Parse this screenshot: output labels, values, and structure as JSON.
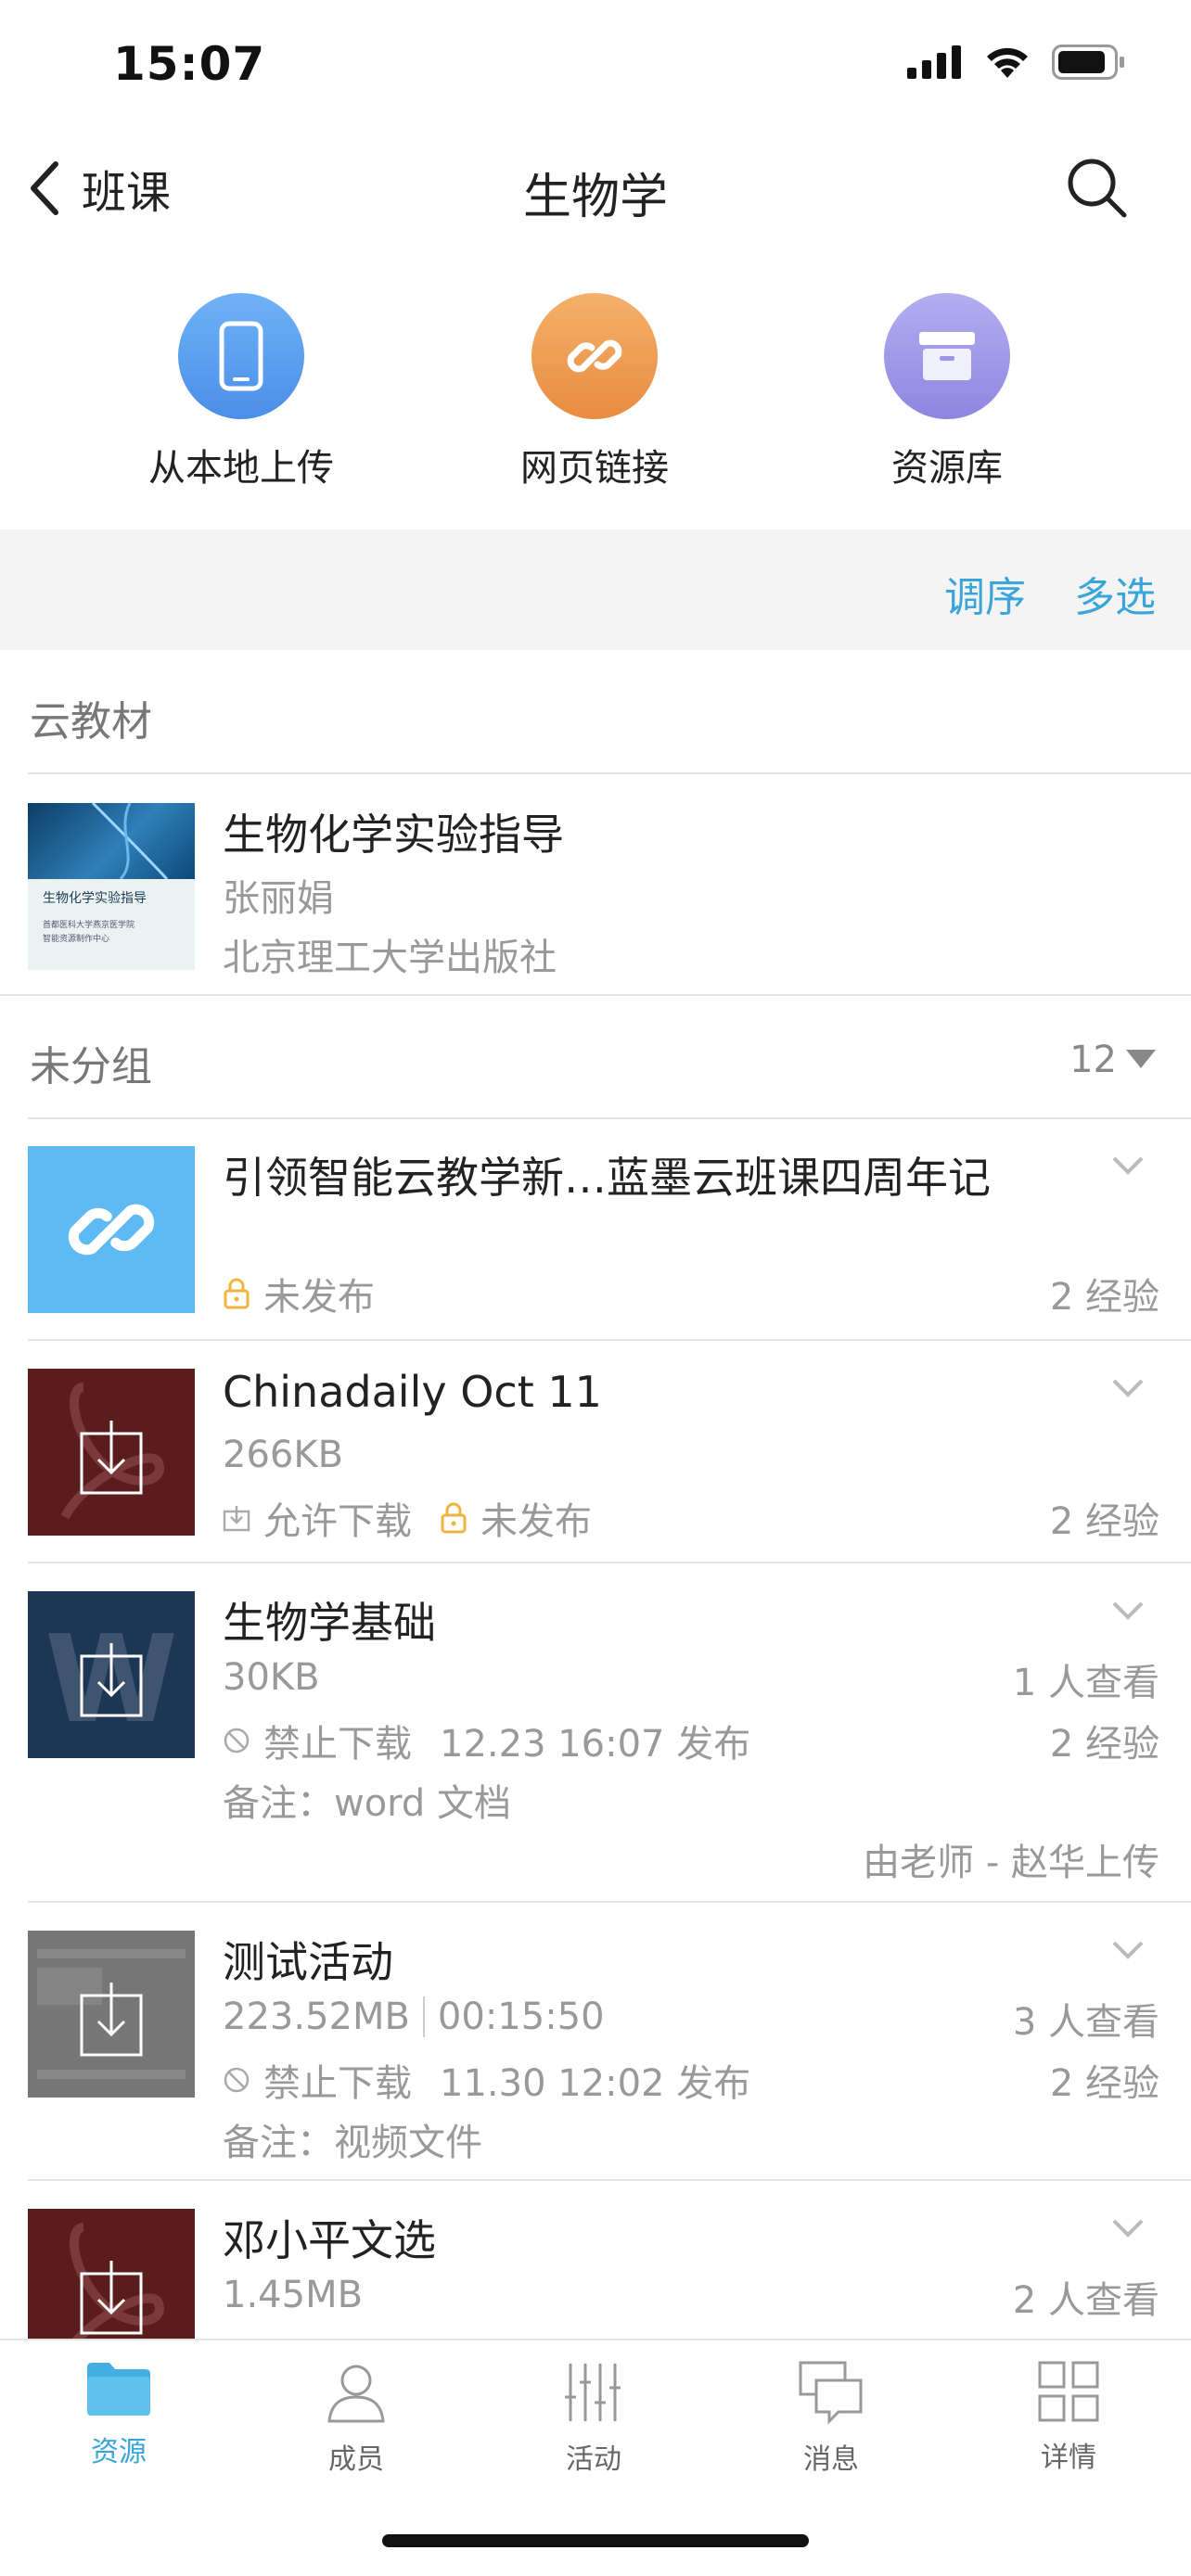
{
  "status": {
    "time": "15:07"
  },
  "nav": {
    "back_label": "班课",
    "title": "生物学"
  },
  "quick_actions": [
    {
      "label": "从本地上传",
      "icon": "phone-icon",
      "color": "#5aa0f0"
    },
    {
      "label": "网页链接",
      "icon": "link-icon",
      "color": "#ef9a50"
    },
    {
      "label": "资源库",
      "icon": "archive-icon",
      "color": "#9c96e8"
    }
  ],
  "toolbar": {
    "reorder_label": "调序",
    "multiselect_label": "多选"
  },
  "cloud_section": {
    "title": "云教材",
    "book": {
      "title": "生物化学实验指导",
      "author": "张丽娟",
      "publisher": "北京理工大学出版社",
      "cover_title": "生物化学实验指导",
      "cover_org": "首都医科大学燕京医学院",
      "cover_sub": "智能资源制作中心"
    }
  },
  "ungrouped": {
    "title": "未分组",
    "count": "12"
  },
  "items": [
    {
      "title": "引领智能云教学新…蓝墨云班课四周年记",
      "status": "未发布",
      "exp": "2 经验"
    },
    {
      "title": "Chinadaily Oct 11",
      "size": "266KB",
      "download": "允许下载",
      "status": "未发布",
      "exp": "2 经验"
    },
    {
      "title": "生物学基础",
      "size": "30KB",
      "download": "禁止下载",
      "publish": "12.23 16:07 发布",
      "views": "1 人查看",
      "exp": "2 经验",
      "note": "备注：word 文档",
      "uploader": "由老师 - 赵华上传"
    },
    {
      "title": "测试活动",
      "size": "223.52MB",
      "duration": "00:15:50",
      "download": "禁止下载",
      "publish": "11.30 12:02 发布",
      "views": "3 人查看",
      "exp": "2 经验",
      "note": "备注：视频文件"
    },
    {
      "title": "邓小平文选",
      "size": "1.45MB",
      "views": "2 人查看"
    }
  ],
  "tabs": [
    {
      "label": "资源",
      "icon": "folder-icon",
      "active": true
    },
    {
      "label": "成员",
      "icon": "person-icon"
    },
    {
      "label": "活动",
      "icon": "activity-icon"
    },
    {
      "label": "消息",
      "icon": "message-icon"
    },
    {
      "label": "详情",
      "icon": "grid-icon"
    }
  ],
  "colors": {
    "accent": "#3aa5d8",
    "lock": "#f0b43c"
  }
}
